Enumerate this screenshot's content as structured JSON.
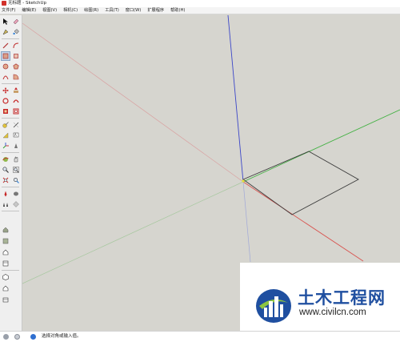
{
  "window": {
    "title": "无标题 - SketchUp"
  },
  "menu": [
    "文件(F)",
    "编辑(E)",
    "视图(V)",
    "相机(C)",
    "绘图(R)",
    "工具(T)",
    "窗口(W)",
    "扩展程序",
    "帮助(H)"
  ],
  "toolbar": {
    "tools": [
      "select-tool-icon",
      "eraser-tool-icon",
      "lasso-select-icon",
      "paint-bucket-icon",
      "line-tool-icon",
      "arc-tool-icon",
      "rectangle-tool-icon",
      "rotated-rectangle-icon",
      "circle-tool-icon",
      "polygon-tool-icon",
      "two-point-arc-icon",
      "pie-tool-icon",
      "move-tool-icon",
      "push-pull-icon",
      "rotate-tool-icon",
      "follow-me-icon",
      "scale-tool-icon",
      "offset-tool-icon",
      "tape-measure-icon",
      "dimension-tool-icon",
      "protractor-icon",
      "text-tool-icon",
      "axes-tool-icon",
      "3d-text-icon",
      "orbit-tool-icon",
      "pan-tool-icon",
      "zoom-tool-icon",
      "zoom-window-icon",
      "zoom-extents-icon",
      "previous-view-icon",
      "position-camera-icon",
      "walk-tool-icon",
      "look-around-icon",
      "section-plane-icon",
      "warehouse-icon",
      "components-icon",
      "extension-warehouse-icon",
      "layout-icon",
      "iso-view-icon",
      "top-view-icon",
      "front-view-icon",
      "right-view-icon",
      "back-view-icon",
      "left-view-icon"
    ]
  },
  "colors": {
    "canvas": "#d6d5cf",
    "red_axis": "#d9534f",
    "green_axis": "#43b143",
    "blue_axis": "#3b46c8",
    "edges": "#3c3c3c",
    "watermark_blue": "#1f4fa0"
  },
  "status": {
    "icons": [
      "info-icon",
      "user-icon",
      "help-icon"
    ],
    "text": "选择对角或输入值。"
  },
  "watermark": {
    "title": "土木工程网",
    "url": "www.civilcn.com"
  }
}
